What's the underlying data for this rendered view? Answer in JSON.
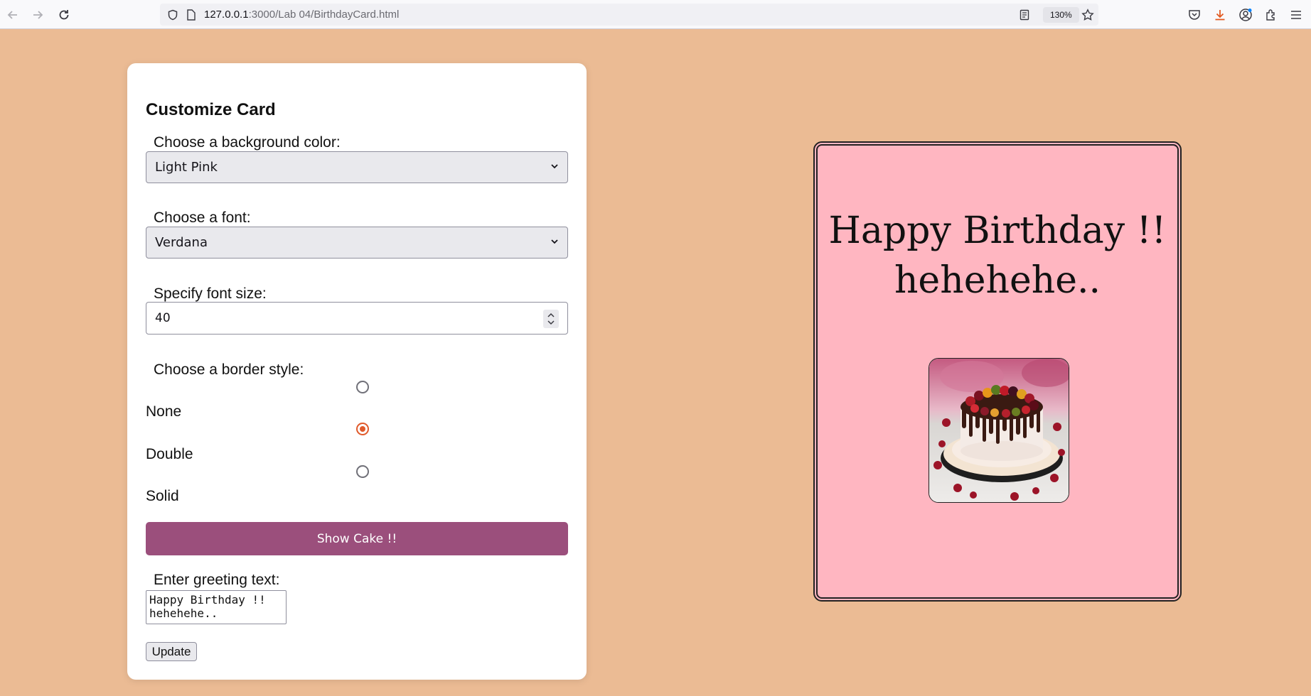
{
  "browser": {
    "url_host": "127.0.0.1",
    "url_rest": ":3000/Lab 04/BirthdayCard.html",
    "zoom": "130%"
  },
  "form": {
    "title": "Customize Card",
    "bg_color": {
      "label": "Choose a background color:",
      "value": "Light Pink"
    },
    "font": {
      "label": "Choose a font:",
      "value": "Verdana"
    },
    "font_size": {
      "label": "Specify font size:",
      "value": "40"
    },
    "border": {
      "label": "Choose a border style:",
      "options": [
        {
          "label": "None",
          "checked": false
        },
        {
          "label": "Double",
          "checked": true
        },
        {
          "label": "Solid",
          "checked": false
        }
      ]
    },
    "show_cake_label": "Show Cake !!",
    "greeting": {
      "label": "Enter greeting text:",
      "value": "Happy Birthday !!\nhehehehe.."
    },
    "update_label": "Update"
  },
  "card": {
    "text": "Happy Birthday !!\nhehehehe..",
    "background": "#ffb6c1"
  },
  "colors": {
    "page_bg": "#ebbb94",
    "button_purple": "#9b4f7c",
    "radio_accent": "#e05a2b"
  },
  "icons": [
    "back-arrow-icon",
    "forward-arrow-icon",
    "reload-icon",
    "shield-icon",
    "page-icon",
    "reader-view-icon",
    "bookmark-star-icon",
    "pocket-icon",
    "download-icon",
    "account-icon",
    "extensions-icon",
    "menu-icon",
    "chevron-down-icon"
  ]
}
